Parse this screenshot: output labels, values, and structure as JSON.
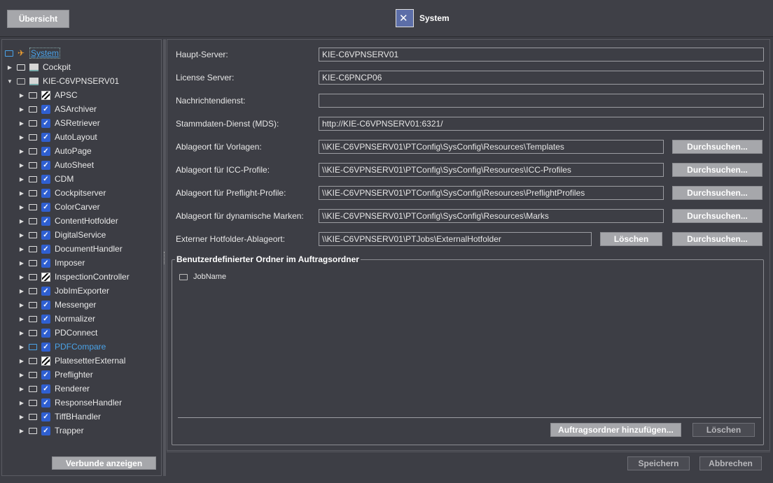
{
  "header": {
    "overview_button": "Übersicht",
    "title": "System",
    "title_icon": "system-tools-icon"
  },
  "tree": {
    "root": "System",
    "cockpit": "Cockpit",
    "server": "KIE-C6VPNSERV01",
    "items": [
      {
        "label": "APSC",
        "icon": "stripe"
      },
      {
        "label": "ASArchiver",
        "icon": "check"
      },
      {
        "label": "ASRetriever",
        "icon": "check"
      },
      {
        "label": "AutoLayout",
        "icon": "check"
      },
      {
        "label": "AutoPage",
        "icon": "check"
      },
      {
        "label": "AutoSheet",
        "icon": "check"
      },
      {
        "label": "CDM",
        "icon": "check"
      },
      {
        "label": "Cockpitserver",
        "icon": "check"
      },
      {
        "label": "ColorCarver",
        "icon": "check"
      },
      {
        "label": "ContentHotfolder",
        "icon": "check"
      },
      {
        "label": "DigitalService",
        "icon": "check"
      },
      {
        "label": "DocumentHandler",
        "icon": "check"
      },
      {
        "label": "Imposer",
        "icon": "check"
      },
      {
        "label": "InspectionController",
        "icon": "stripe"
      },
      {
        "label": "JobImExporter",
        "icon": "check"
      },
      {
        "label": "Messenger",
        "icon": "check"
      },
      {
        "label": "Normalizer",
        "icon": "check"
      },
      {
        "label": "PDConnect",
        "icon": "check"
      },
      {
        "label": "PDFCompare",
        "icon": "check"
      },
      {
        "label": "PlatesetterExternal",
        "icon": "stripe"
      },
      {
        "label": "Preflighter",
        "icon": "check"
      },
      {
        "label": "Renderer",
        "icon": "check"
      },
      {
        "label": "ResponseHandler",
        "icon": "check"
      },
      {
        "label": "TiffBHandler",
        "icon": "check"
      },
      {
        "label": "Trapper",
        "icon": "check"
      }
    ],
    "show_groups_button": "Verbunde anzeigen"
  },
  "form": {
    "main_server_label": "Haupt-Server:",
    "main_server_value": "KIE-C6VPNSERV01",
    "license_server_label": "License Server:",
    "license_server_value": "KIE-C6PNCP06",
    "message_service_label": "Nachrichtendienst:",
    "message_service_value": "",
    "mds_label": "Stammdaten-Dienst (MDS):",
    "mds_value": "http://KIE-C6VPNSERV01:6321/",
    "templates_label": "Ablageort für Vorlagen:",
    "templates_value": "\\\\KIE-C6VPNSERV01\\PTConfig\\SysConfig\\Resources\\Templates",
    "icc_label": "Ablageort für ICC-Profile:",
    "icc_value": "\\\\KIE-C6VPNSERV01\\PTConfig\\SysConfig\\Resources\\ICC-Profiles",
    "preflight_label": "Ablageort für Preflight-Profile:",
    "preflight_value": "\\\\KIE-C6VPNSERV01\\PTConfig\\SysConfig\\Resources\\PreflightProfiles",
    "marks_label": "Ablageort für dynamische Marken:",
    "marks_value": "\\\\KIE-C6VPNSERV01\\PTConfig\\SysConfig\\Resources\\Marks",
    "hotfolder_label": "Externer Hotfolder-Ablageort:",
    "hotfolder_value": "\\\\KIE-C6VPNSERV01\\PTJobs\\ExternalHotfolder",
    "browse_button": "Durchsuchen...",
    "delete_button": "Löschen"
  },
  "job_folder_group": {
    "title": "Benutzerdefinierter Ordner im Auftragsordner",
    "items": [
      "JobName"
    ],
    "add_button": "Auftragsordner hinzufügen...",
    "delete_button": "Löschen"
  },
  "footer": {
    "save_button": "Speichern",
    "cancel_button": "Abbrechen"
  }
}
